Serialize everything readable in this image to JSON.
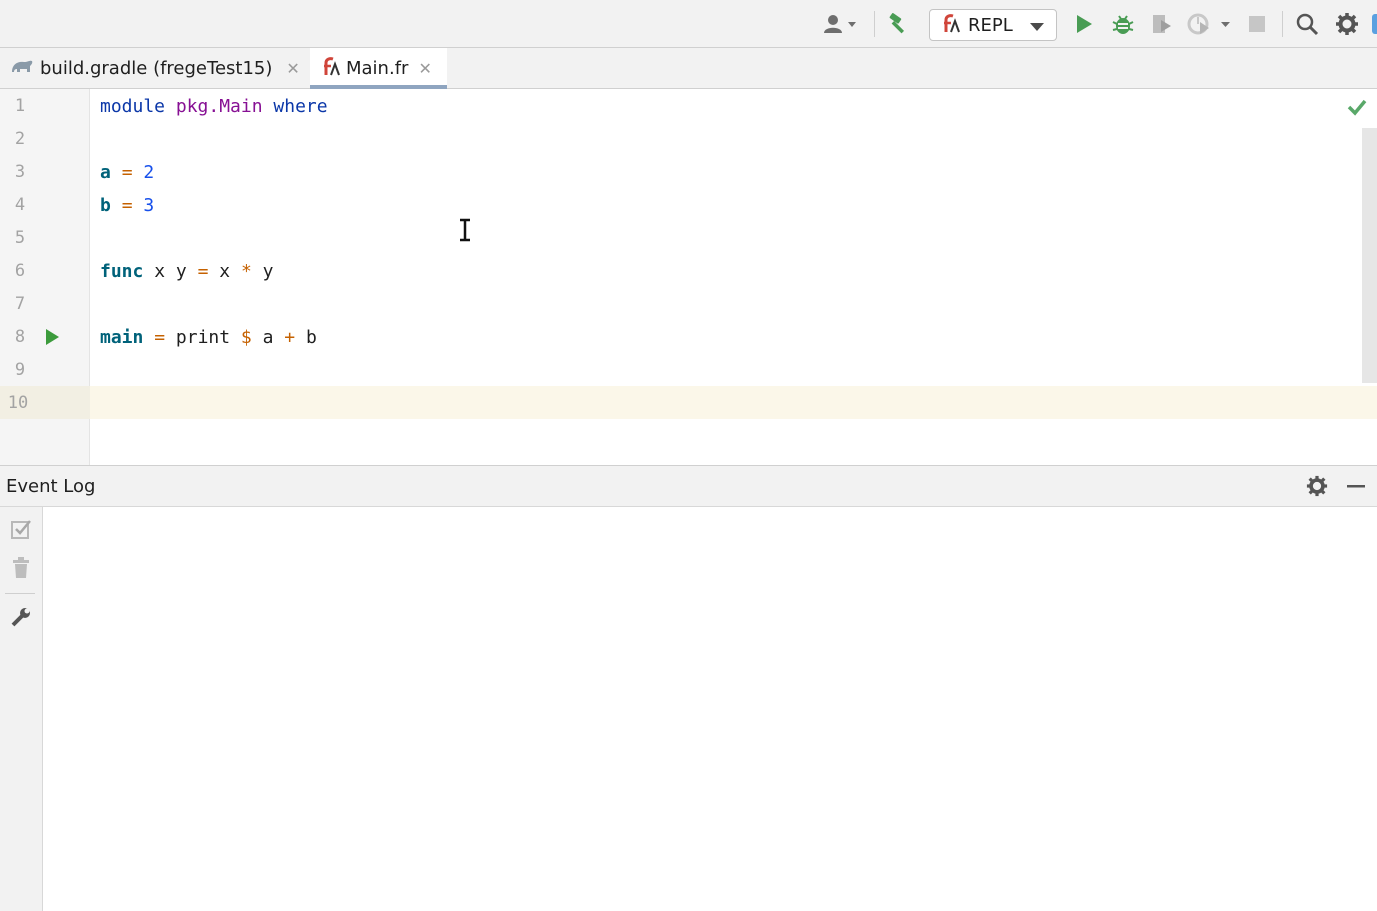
{
  "toolbar": {
    "run_config": {
      "label": "REPL"
    },
    "icons": [
      "user-icon",
      "build-hammer-icon",
      "frege-icon",
      "run-icon",
      "debug-icon",
      "coverage-icon",
      "profile-icon",
      "stop-icon",
      "search-icon",
      "settings-gear-icon"
    ]
  },
  "tabs": [
    {
      "label": "build.gradle (fregeTest15)",
      "icon": "gradle-icon",
      "active": false
    },
    {
      "label": "Main.fr",
      "icon": "frege-file-icon",
      "active": true
    }
  ],
  "editor": {
    "line_numbers": [
      "1",
      "2",
      "3",
      "4",
      "5",
      "6",
      "7",
      "8",
      "9",
      "10"
    ],
    "code": {
      "l1": {
        "kw_module": "module",
        "modname": "pkg.Main",
        "kw_where": "where"
      },
      "l3": {
        "name": "a",
        "eq": "=",
        "val": "2"
      },
      "l4": {
        "name": "b",
        "eq": "=",
        "val": "3"
      },
      "l6": {
        "name": "func",
        "args": "x y",
        "eq": "=",
        "x": "x",
        "op": "*",
        "y": "y"
      },
      "l8": {
        "name": "main",
        "eq": "=",
        "fn": "print",
        "dollar": "$",
        "a": "a",
        "plus": "+",
        "b": "b"
      }
    },
    "caret_line": 10,
    "colors": {
      "keyword": "#0b37a8",
      "module": "#871094",
      "identifier": "#00627a",
      "number": "#1750eb",
      "operator": "#c56100",
      "inspection_ok": "#59a869",
      "run_gutter": "#3c9b3c"
    }
  },
  "event_log": {
    "title": "Event Log"
  }
}
